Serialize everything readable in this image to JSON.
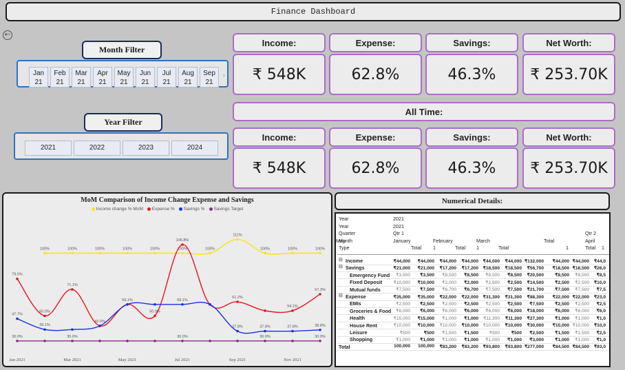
{
  "header": {
    "title": "Finance Dashboard"
  },
  "month_filter": {
    "label": "Month Filter",
    "months": [
      {
        "m": "Jan",
        "y": "21"
      },
      {
        "m": "Feb",
        "y": "21"
      },
      {
        "m": "Mar",
        "y": "21"
      },
      {
        "m": "Apr",
        "y": "21"
      },
      {
        "m": "May",
        "y": "21"
      },
      {
        "m": "Jun",
        "y": "21"
      },
      {
        "m": "Jul",
        "y": "21"
      },
      {
        "m": "Aug",
        "y": "21"
      },
      {
        "m": "Sep",
        "y": "21"
      }
    ]
  },
  "year_filter": {
    "label": "Year Filter",
    "years": [
      "2021",
      "2022",
      "2023",
      "2024"
    ]
  },
  "kpis_filtered": {
    "income_label": "Income:",
    "income_value": "₹ 548K",
    "expense_label": "Expense:",
    "expense_value": "62.8%",
    "savings_label": "Savings:",
    "savings_value": "46.3%",
    "networth_label": "Net Worth:",
    "networth_value": "₹ 253.70K"
  },
  "all_time_label": "All Time:",
  "kpis_all_time": {
    "income_label": "Income:",
    "income_value": "₹ 548K",
    "expense_label": "Expense:",
    "expense_value": "62.8%",
    "savings_label": "Savings:",
    "savings_value": "46.3%",
    "networth_label": "Net Worth:",
    "networth_value": "₹ 253.70K"
  },
  "chart_data": {
    "type": "line",
    "title": "MoM Comparison of Income Change Expense and Savings",
    "x": [
      "Jan 2021",
      "Feb 2021",
      "Mar 2021",
      "Apr 2021",
      "May 2021",
      "Jun 2021",
      "Jul 2021",
      "Aug 2021",
      "Sep 2021",
      "Oct 2021",
      "Nov 2021",
      "Dec 2021"
    ],
    "x_tick_labels": [
      "Jan 2021",
      "Mar 2021",
      "May 2021",
      "Jul 2021",
      "Sep 2021",
      "Nov 2021"
    ],
    "series": [
      {
        "name": "Income change % MoM",
        "color": "#f5e61e",
        "values": [
          null,
          100,
          100,
          100,
          100,
          100,
          100,
          100,
          111,
          100,
          100,
          100
        ],
        "labels": [
          "",
          "100%",
          "100%",
          "100%",
          "100%",
          "100%",
          "100%",
          "100%",
          "111%",
          "100%",
          "100%",
          "100%"
        ]
      },
      {
        "name": "Expense %",
        "color": "#e8141c",
        "values": [
          79.5,
          50.0,
          71.1,
          42.0,
          59.1,
          50.0,
          106.8,
          59.1,
          61.2,
          54.1,
          54.1,
          67.3
        ],
        "labels": [
          "79.5%",
          "50.0%",
          "71.1%",
          "42.0%",
          "59.1%",
          "50.0%",
          "106.8%",
          "",
          "61.2%",
          "",
          "54.1%",
          "67.3%"
        ]
      },
      {
        "name": "Savings %",
        "color": "#1a2fe0",
        "values": [
          47.7,
          39.1,
          39.1,
          42.0,
          59.1,
          59.1,
          59.1,
          59.1,
          37.8,
          37.8,
          37.8,
          38.8
        ],
        "labels": [
          "47.7%",
          "39.1%",
          "",
          "",
          "",
          "",
          "59.1%",
          "",
          "37.8%",
          "37.8%",
          "37.8%",
          "38.8%"
        ]
      },
      {
        "name": "Savings Target",
        "color": "#8a2a8a",
        "values": [
          30,
          30,
          30,
          30,
          30,
          30,
          30,
          30,
          30,
          30,
          30,
          30
        ],
        "labels": [
          "30.0%",
          "",
          "30.0%",
          "",
          "",
          "",
          "30.0%",
          "",
          "",
          "30.0%",
          "",
          "30.0%"
        ]
      }
    ],
    "ylim": [
      20,
      120
    ],
    "legend": "top-center",
    "grid": false
  },
  "numerical": {
    "title": "Numerical Details:",
    "header_rows": [
      {
        "label": "Year",
        "cells": [
          {
            "t": "2021",
            "col": 0
          }
        ]
      },
      {
        "label": "Year",
        "cells": [
          {
            "t": "2021",
            "col": 0
          }
        ]
      },
      {
        "label": "Quarter",
        "cells": [
          {
            "t": "Qtr 1",
            "col": 0
          },
          {
            "t": "Qtr 2",
            "col": 9
          }
        ]
      },
      {
        "label": "Month",
        "cells": [
          {
            "t": "January",
            "col": 0
          },
          {
            "t": "February",
            "col": 2
          },
          {
            "t": "March",
            "col": 4
          },
          {
            "t": "Total",
            "col": 7
          },
          {
            "t": "April",
            "col": 9
          },
          {
            "t": "May",
            "col": 11
          }
        ]
      },
      {
        "label": "Type",
        "cells": [
          {
            "t": "Total",
            "col": 1
          },
          {
            "t": "1",
            "col": 2
          },
          {
            "t": "Total",
            "col": 3
          },
          {
            "t": "1",
            "col": 4
          },
          {
            "t": "Total",
            "col": 5
          },
          {
            "t": "1",
            "col": 8
          },
          {
            "t": "Total",
            "col": 9
          },
          {
            "t": "1",
            "col": 10
          }
        ]
      }
    ],
    "rows": [
      {
        "label": "Income",
        "kind": "group",
        "vals": [
          "₹44,000",
          "₹44,000",
          "₹44,000",
          "₹44,000",
          "₹44,000",
          "₹44,000",
          "₹132,000",
          "₹44,000",
          "₹44,000",
          "₹44,0"
        ]
      },
      {
        "label": "Savings",
        "kind": "group",
        "vals": [
          "₹21,000",
          "₹21,000",
          "₹17,200",
          "₹17,200",
          "₹18,500",
          "₹18,500",
          "₹56,700",
          "₹18,500",
          "₹18,500",
          "₹26,0"
        ]
      },
      {
        "label": "Emergency Fund",
        "kind": "child",
        "vals": [
          "₹3,500",
          "₹3,500",
          "₹8,500",
          "₹8,500",
          "₹8,500",
          "₹8,500",
          "₹20,500",
          "₹8,500",
          "₹8,500",
          "₹8,5"
        ]
      },
      {
        "label": "Fixed Deposit",
        "kind": "child",
        "vals": [
          "₹10,000",
          "₹10,000",
          "₹2,000",
          "₹2,000",
          "₹2,500",
          "₹2,500",
          "₹14,500",
          "₹2,500",
          "₹2,500",
          "₹10,0"
        ]
      },
      {
        "label": "Mutual funds",
        "kind": "child",
        "vals": [
          "₹7,500",
          "₹7,500",
          "₹6,700",
          "₹6,700",
          "₹7,500",
          "₹7,500",
          "₹21,700",
          "₹7,500",
          "₹7,500",
          "₹7,5"
        ]
      },
      {
        "label": "Expense",
        "kind": "group",
        "vals": [
          "₹35,000",
          "₹35,000",
          "₹22,000",
          "₹22,000",
          "₹31,300",
          "₹31,300",
          "₹88,300",
          "₹22,000",
          "₹22,000",
          "₹23,0"
        ]
      },
      {
        "label": "EMIs",
        "kind": "child",
        "vals": [
          "₹2,500",
          "₹2,500",
          "₹2,500",
          "₹2,500",
          "₹2,500",
          "₹2,500",
          "₹7,500",
          "₹2,500",
          "₹2,500",
          "₹2,5"
        ]
      },
      {
        "label": "Groceries & Food",
        "kind": "child",
        "vals": [
          "₹6,000",
          "₹6,000",
          "₹6,000",
          "₹6,000",
          "₹6,000",
          "₹6,000",
          "₹18,000",
          "₹6,000",
          "₹6,000",
          "₹6,0"
        ]
      },
      {
        "label": "Health",
        "kind": "child",
        "vals": [
          "₹15,000",
          "₹15,000",
          "₹1,000",
          "₹1,000",
          "₹11,300",
          "₹11,300",
          "₹27,300",
          "₹1,000",
          "₹1,000",
          "₹1,0"
        ]
      },
      {
        "label": "House Rent",
        "kind": "child",
        "vals": [
          "₹10,000",
          "₹10,000",
          "₹10,000",
          "₹10,000",
          "₹10,000",
          "₹10,000",
          "₹30,000",
          "₹10,000",
          "₹10,000",
          "₹10,0"
        ]
      },
      {
        "label": "Leisure",
        "kind": "child",
        "vals": [
          "₹500",
          "₹500",
          "₹1,500",
          "₹1,500",
          "₹500",
          "₹500",
          "₹2,500",
          "₹1,500",
          "₹1,500",
          "₹2,5"
        ]
      },
      {
        "label": "Shopping",
        "kind": "child",
        "vals": [
          "₹1,000",
          "₹1,000",
          "₹1,000",
          "₹1,000",
          "₹1,000",
          "₹1,000",
          "₹3,000",
          "₹1,000",
          "₹1,000",
          "₹1,0"
        ]
      },
      {
        "label": "Total",
        "kind": "total",
        "vals": [
          "100,000",
          "100,000",
          "₹83,200",
          "₹83,200",
          "₹93,800",
          "₹93,800",
          "₹277,000",
          "₹84,500",
          "₹84,500",
          "₹93,0"
        ]
      }
    ]
  }
}
